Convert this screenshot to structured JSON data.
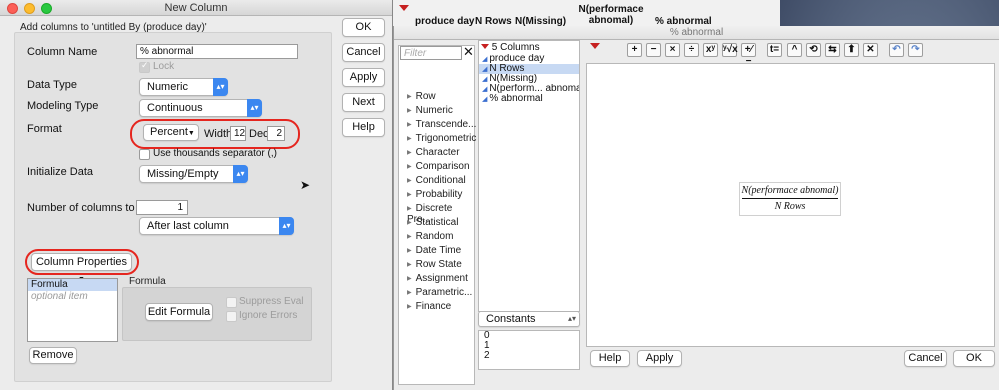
{
  "background_table": {
    "columns": [
      "produce day",
      "N Rows",
      "N(Missing)",
      "N(performace abnomal)",
      "% abnormal"
    ]
  },
  "new_column": {
    "title": "New Column",
    "subtitle": "Add columns to 'untitled By (produce day)'",
    "column_name_label": "Column Name",
    "column_name_value": "% abnormal",
    "lock_label": "Lock",
    "data_type_label": "Data Type",
    "data_type_value": "Numeric",
    "modeling_type_label": "Modeling Type",
    "modeling_type_value": "Continuous",
    "format_label": "Format",
    "format_value": "Percent",
    "width_label": "Width",
    "width_value": "12",
    "dec_label": "Dec",
    "dec_value": "2",
    "thousands_label": "Use thousands separator (,)",
    "initialize_label": "Initialize Data",
    "initialize_value": "Missing/Empty",
    "num_columns_label": "Number of columns to add",
    "num_columns_value": "1",
    "position_value": "After last column",
    "column_properties_label": "Column Properties",
    "properties_list": [
      "Formula",
      "optional item"
    ],
    "formula_group_label": "Formula",
    "edit_formula_label": "Edit Formula",
    "suppress_eval_label": "Suppress Eval",
    "ignore_errors_label": "Ignore Errors",
    "remove_label": "Remove",
    "buttons": {
      "ok": "OK",
      "cancel": "Cancel",
      "apply": "Apply",
      "next": "Next",
      "help": "Help"
    }
  },
  "formula_editor": {
    "title": "% abnormal",
    "filter_placeholder": "Filter",
    "columns_header": "5 Columns",
    "columns": [
      "produce day",
      "N Rows",
      "N(Missing)",
      "N(perform... abnomal)",
      "% abnormal"
    ],
    "function_groups": [
      "Row",
      "Numeric",
      "Transcende...",
      "Trigonometric",
      "Character",
      "Comparison",
      "Conditional",
      "Probability",
      "Discrete Pro...",
      "Statistical",
      "Random",
      "Date Time",
      "Row State",
      "Assignment",
      "Parametric...",
      "Finance"
    ],
    "constants_select": "Constants",
    "constants": [
      "0",
      "1",
      "2"
    ],
    "toolbar": [
      "+",
      "−",
      "×",
      "÷",
      "xʸ",
      "ʸ√x",
      "+⁄−",
      "t=",
      "^",
      "⟲",
      "⇆",
      "⬆",
      "✕",
      "↶",
      "↷"
    ],
    "formula": {
      "numerator": "N(performace abnomal)",
      "denominator": "N Rows"
    },
    "buttons": {
      "help": "Help",
      "apply": "Apply",
      "cancel": "Cancel",
      "ok": "OK"
    }
  },
  "colors": {
    "highlight_circle": "#e5261f",
    "select_blue": "#3b87f0",
    "list_selection": "#c7d9f3"
  }
}
